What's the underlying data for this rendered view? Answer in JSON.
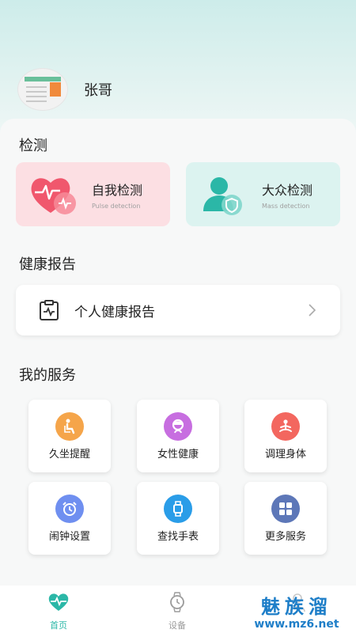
{
  "user": {
    "name": "张哥"
  },
  "detection": {
    "title": "检测",
    "self": {
      "label": "自我检测",
      "sub": "Pulse detection",
      "color": "#f0576d"
    },
    "mass": {
      "label": "大众检测",
      "sub": "Mass detection",
      "color": "#2bb7a7"
    }
  },
  "report": {
    "title": "健康报告",
    "item": "个人健康报告"
  },
  "services": {
    "title": "我的服务",
    "items": [
      {
        "label": "久坐提醒",
        "icon": "sitting-icon",
        "color": "#f5a54a"
      },
      {
        "label": "女性健康",
        "icon": "female-icon",
        "color": "#c76ee0"
      },
      {
        "label": "调理身体",
        "icon": "meditation-icon",
        "color": "#f3675f"
      },
      {
        "label": "闹钟设置",
        "icon": "alarm-clock-icon",
        "color": "#6f8ff0"
      },
      {
        "label": "查找手表",
        "icon": "watch-icon",
        "color": "#2a9de8"
      },
      {
        "label": "更多服务",
        "icon": "grid-icon",
        "color": "#5d77b8"
      }
    ]
  },
  "tabs": [
    {
      "label": "首页",
      "icon": "heartbeat-icon",
      "active": true,
      "color": "#2bb7a7"
    },
    {
      "label": "设备",
      "icon": "watch-icon",
      "active": false,
      "color": "#9b9b9b"
    }
  ],
  "watermark": {
    "text": "魅族溜",
    "url": "www.mz6.net"
  }
}
